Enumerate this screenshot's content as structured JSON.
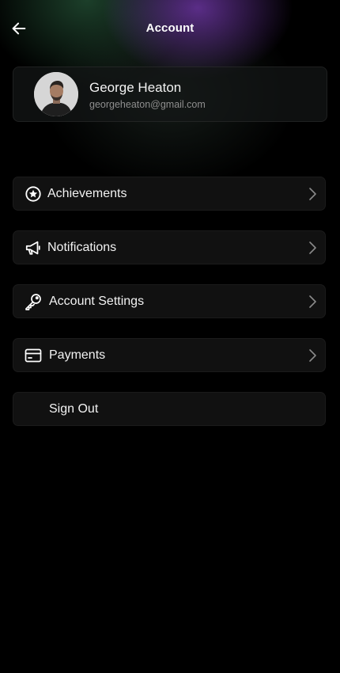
{
  "header": {
    "title": "Account",
    "back_icon": "arrow-left-icon"
  },
  "profile": {
    "name": "George Heaton",
    "email": "georgeheaton@gmail.com",
    "avatar": "profile-photo"
  },
  "menu": [
    {
      "label": "Achievements",
      "icon": "star-badge-icon",
      "chevron": true
    },
    {
      "label": "Notifications",
      "icon": "megaphone-icon",
      "chevron": true
    },
    {
      "label": "Account Settings",
      "icon": "key-icon",
      "chevron": true
    },
    {
      "label": "Payments",
      "icon": "credit-card-icon",
      "chevron": true
    },
    {
      "label": "Sign Out",
      "icon": "",
      "chevron": false
    }
  ],
  "colors": {
    "background": "#000000",
    "card": "#111111",
    "text": "#f2f2f2",
    "muted": "#8e8e8e",
    "glow_purple": "#783cb4",
    "glow_green": "#285a3c"
  }
}
